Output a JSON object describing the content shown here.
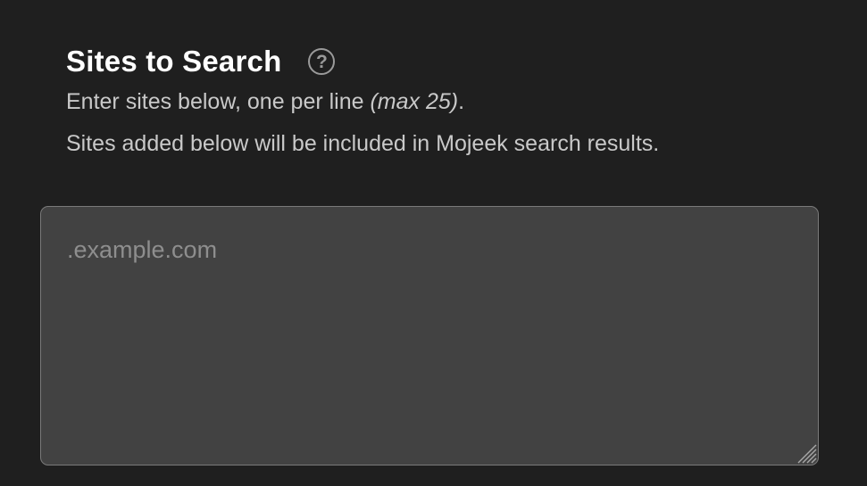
{
  "section": {
    "title": "Sites to Search",
    "help_icon": "question-circle-icon",
    "help_glyph": "?",
    "description_line1_prefix": "Enter sites below, one per line ",
    "description_line1_emphasis": "(max 25)",
    "description_line1_suffix": ".",
    "description_line2": "Sites added below will be included in Mojeek search results."
  },
  "sites_input": {
    "value": "",
    "placeholder": ".example.com",
    "resize_icon": "resize-grip-icon"
  },
  "colors": {
    "background": "#1f1f1f",
    "textarea_background": "#424242",
    "title": "#ffffff",
    "body_text": "#c9c9c9",
    "placeholder": "#8e8e8e"
  }
}
